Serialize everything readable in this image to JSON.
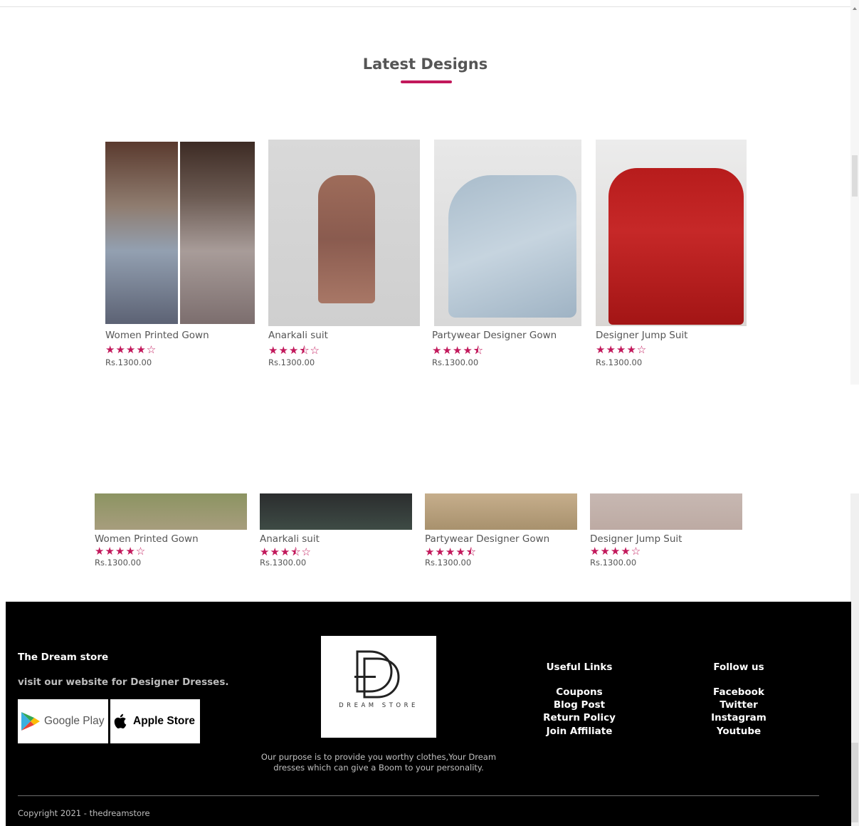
{
  "section": {
    "title": "Latest Designs"
  },
  "products_top": [
    {
      "name": "Women Printed Gown",
      "stars": "★★★★☆",
      "rating": 4,
      "price": "Rs.1300.00"
    },
    {
      "name": "Anarkali suit",
      "stars": "★★★⯪☆",
      "rating": 3.5,
      "price": "Rs.1300.00"
    },
    {
      "name": "Partywear Designer Gown",
      "stars": "★★★★⯪",
      "rating": 4.5,
      "price": "Rs.1300.00"
    },
    {
      "name": "Designer Jump Suit",
      "stars": "★★★★☆",
      "rating": 4,
      "price": "Rs.1300.00"
    }
  ],
  "products_bottom": [
    {
      "name": "Women Printed Gown",
      "stars": "★★★★☆",
      "rating": 4,
      "price": "Rs.1300.00"
    },
    {
      "name": "Anarkali suit",
      "stars": "★★★⯪☆",
      "rating": 3.5,
      "price": "Rs.1300.00"
    },
    {
      "name": "Partywear Designer Gown",
      "stars": "★★★★⯪",
      "rating": 4.5,
      "price": "Rs.1300.00"
    },
    {
      "name": "Designer Jump Suit",
      "stars": "★★★★☆",
      "rating": 4,
      "price": "Rs.1300.00"
    }
  ],
  "footer": {
    "brand": "The Dream store",
    "tagline": "visit our website for Designer Dresses.",
    "google_play": "Google Play",
    "apple_store": "Apple Store",
    "logo_text": "DREAM STORE",
    "purpose": "Our purpose is to provide you worthy clothes,Your Dream dresses which can give a Boom to your personality.",
    "useful_links": {
      "heading": "Useful Links",
      "items": [
        "Coupons",
        "Blog Post",
        "Return Policy",
        "Join Affiliate"
      ]
    },
    "follow_us": {
      "heading": "Follow us",
      "items": [
        "Facebook",
        "Twitter",
        "Instagram",
        "Youtube"
      ]
    },
    "copyright": "Copyright 2021 - thedreamstore"
  },
  "colors": {
    "accent": "#c2185b",
    "footer_bg": "#000000"
  }
}
